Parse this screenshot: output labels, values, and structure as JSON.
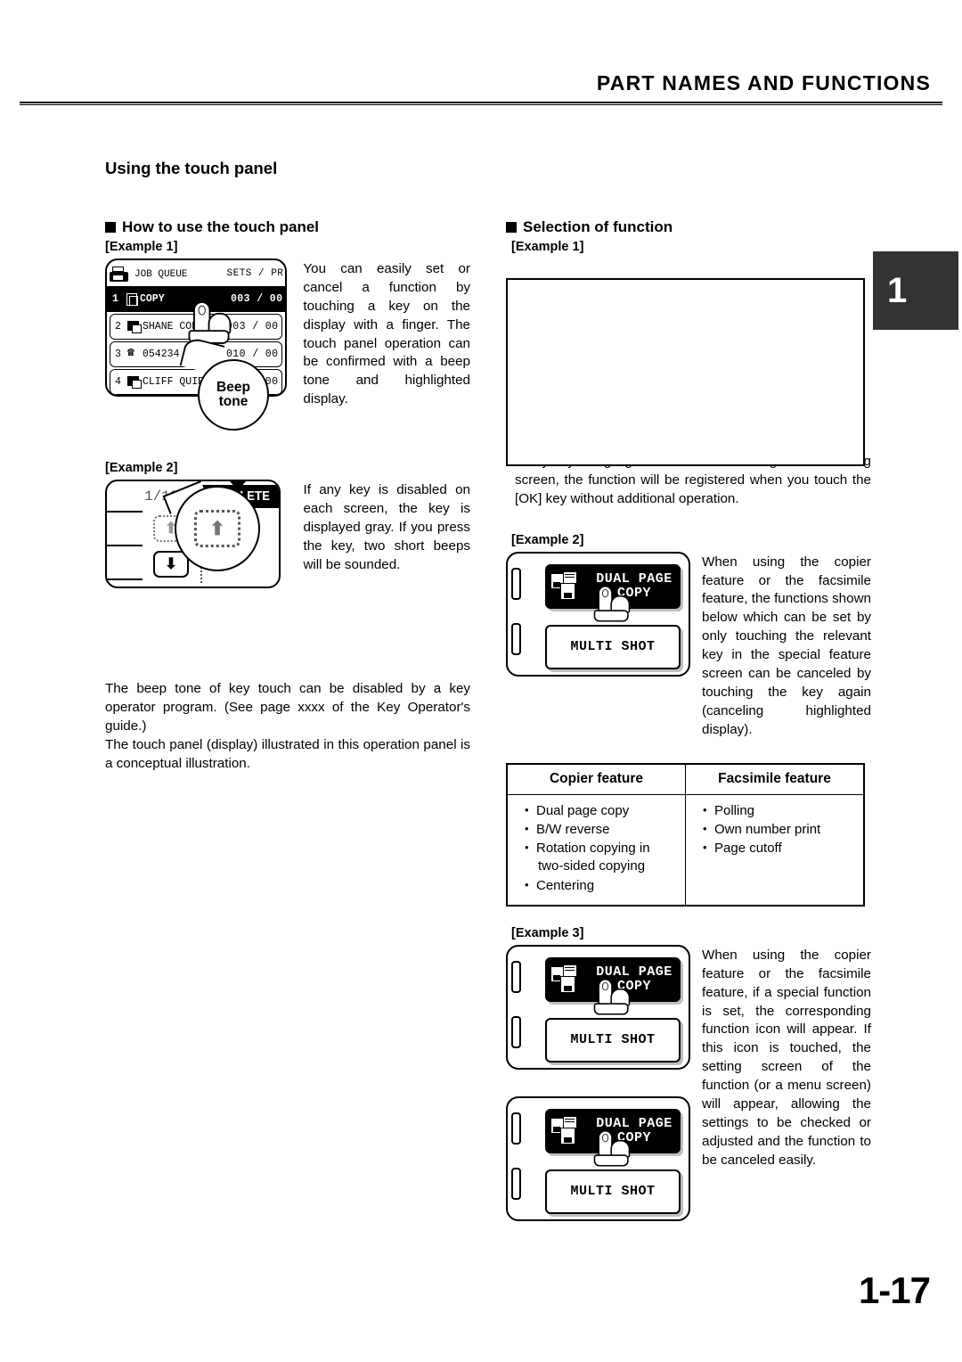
{
  "header": {
    "title": "PART NAMES AND FUNCTIONS"
  },
  "chapter_tab": {
    "number": "1"
  },
  "section": {
    "title": "Using the touch panel"
  },
  "page": {
    "number": "1-17"
  },
  "left_column": {
    "heading": "How to use the touch panel",
    "example1": {
      "label": "[Example 1]",
      "text": "You can easily set or cancel a function by touching a key on the display with a finger. The touch panel operation can be confirmed with a beep tone and highlighted display.",
      "callout": {
        "line1": "Beep",
        "line2": "tone"
      },
      "screen": {
        "title": "JOB QUEUE",
        "columns": "SETS / PR",
        "rows": [
          {
            "num": "1",
            "icon": "document-icon",
            "name": "COPY",
            "count": "003 / 00",
            "selected": true
          },
          {
            "num": "2",
            "icon": "computer-icon",
            "name": "SHANE COP",
            "count": "003 / 00",
            "selected": false
          },
          {
            "num": "3",
            "icon": "fax-icon",
            "name": "054234",
            "count": "010 / 00",
            "selected": false
          },
          {
            "num": "4",
            "icon": "computer-icon",
            "name": "CLIFF QUIROGA",
            "count": "/ 00",
            "selected": false
          }
        ]
      }
    },
    "example2": {
      "label": "[Example 2]",
      "text": "If any key is disabled on each screen, the key is displayed gray. If you press the key, two short beeps will be sounded.",
      "screen": {
        "page_count": "1/13",
        "complete_key": "COMPLETE",
        "arrow_up": "⬆",
        "arrow_down": "⬇"
      }
    },
    "notes": [
      "The beep tone of key touch can be disabled by a key operator program. (See page xxxx of the Key Operator's guide.)",
      "The touch panel (display) illustrated in this operation panel is a conceptual illustration."
    ]
  },
  "right_column": {
    "heading": "Selection of function",
    "example1": {
      "label": "[Example 1]",
      "text": "If any key is highlighted in the initial setting of each setting screen, the function will be registered when you touch the [OK] key without additional operation."
    },
    "example2": {
      "label": "[Example 2]",
      "text": "When using the copier feature or the facsimile feature, the functions shown below which can be set by only touching the relevant key in the special feature screen can be canceled by touching the key again (canceling highlighted display).",
      "screen": {
        "highlighted_key": "DUAL PAGE COPY",
        "plain_key": "MULTI SHOT"
      }
    },
    "feature_table": {
      "headers": [
        "Copier feature",
        "Facsimile feature"
      ],
      "copier_items": [
        {
          "main": "Dual page copy",
          "cont": ""
        },
        {
          "main": "B/W reverse",
          "cont": ""
        },
        {
          "main": "Rotation copying in",
          "cont": "two-sided copying"
        },
        {
          "main": "Centering",
          "cont": ""
        }
      ],
      "facsimile_items": [
        {
          "main": "Polling",
          "cont": ""
        },
        {
          "main": "Own number print",
          "cont": ""
        },
        {
          "main": "Page cutoff",
          "cont": ""
        }
      ]
    },
    "example3": {
      "label": "[Example 3]",
      "text": "When using the copier feature or the facsimile feature, if a special function is set, the corresponding function icon will appear. If this icon is touched, the setting screen of the function (or a menu screen) will appear, allowing the settings to be checked or adjusted and the function to be canceled easily.",
      "screen_a": {
        "highlighted_key": "DUAL PAGE COPY",
        "plain_key": "MULTI SHOT"
      },
      "screen_b": {
        "highlighted_key": "DUAL PAGE COPY",
        "plain_key": "MULTI SHOT"
      }
    }
  }
}
